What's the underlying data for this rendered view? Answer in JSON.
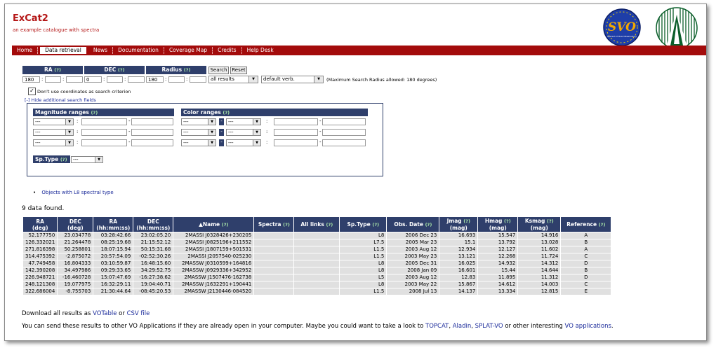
{
  "app": {
    "title": "ExCat2",
    "subtitle": "an example catalogue with spectra",
    "logo_text": "SVO",
    "logo_caption": "Spanish Virtual Observatory"
  },
  "nav": {
    "items": [
      {
        "label": "Home"
      },
      {
        "label": "Data retrieval",
        "active": true
      },
      {
        "label": "News"
      },
      {
        "label": "Documentation"
      },
      {
        "label": "Coverage Map"
      },
      {
        "label": "Credits"
      },
      {
        "label": "Help Desk"
      }
    ]
  },
  "search": {
    "ra_label": "RA",
    "dec_label": "DEC",
    "radius_label": "Radius",
    "help": "(?)",
    "ra_values": [
      "180",
      "",
      ""
    ],
    "dec_values": [
      "0",
      "",
      ""
    ],
    "radius_values": [
      "180",
      "",
      ""
    ],
    "search_button": "Search",
    "reset_button": "Reset",
    "results_select": "all results",
    "verb_select": "default verb.",
    "max_radius_note": "(Maximum Search Radius allowed: 180 degrees)",
    "no_coords_label": "Don't use coordinates as search criterion",
    "hide_fields_link": "[-] Hide additional search fields",
    "magnitude_ranges": "Magnitude ranges",
    "color_ranges": "Color ranges",
    "sptype_label": "Sp.Type",
    "select_placeholder": "---",
    "dash": "-"
  },
  "objects_link": "Objects with L8 spectral type",
  "found_text": "9 data found.",
  "table": {
    "headers": [
      {
        "line1": "RA",
        "line2": "(deg)"
      },
      {
        "line1": "DEC",
        "line2": "(deg)"
      },
      {
        "line1": "RA",
        "line2": "(hh:mm:ss)"
      },
      {
        "line1": "DEC",
        "line2": "(hh:mm:ss)"
      },
      {
        "line1": "▲Name",
        "help": "(?)"
      },
      {
        "line1": "Spectra",
        "help": "(?)"
      },
      {
        "line1": "All links",
        "help": "(?)"
      },
      {
        "line1": "Sp.Type",
        "help": "(?)"
      },
      {
        "line1": "Obs. Date",
        "help": "(?)"
      },
      {
        "line1": "Jmag",
        "help": "(?)",
        "line2": "(mag)"
      },
      {
        "line1": "Hmag",
        "help": "(?)",
        "line2": "(mag)"
      },
      {
        "line1": "Ksmag",
        "help": "(?)",
        "line2": "(mag)"
      },
      {
        "line1": "Reference",
        "help": "(?)"
      }
    ],
    "rows": [
      [
        "52.177750",
        "23.034778",
        "03:28:42.66",
        "23:02:05.20",
        "2MASSI J0328426+230205",
        "",
        "",
        "L8",
        "2006 Dec 23",
        "16.693",
        "15.547",
        "14.916",
        "A"
      ],
      [
        "126.332021",
        "21.264478",
        "08:25:19.68",
        "21:15:52.12",
        "2MASSI J0825196+211552",
        "",
        "",
        "L7.5",
        "2005 Mar 23",
        "15.1",
        "13.792",
        "13.028",
        "B"
      ],
      [
        "271.816398",
        "50.258801",
        "18:07:15.94",
        "50:15:31.68",
        "2MASSI J1807159+501531",
        "",
        "",
        "L1.5",
        "2003 Aug 12",
        "12.934",
        "12.127",
        "11.602",
        "A"
      ],
      [
        "314.475392",
        "-2.875072",
        "20:57:54.09",
        "-02:52:30.26",
        "2MASSI J2057540-025230",
        "",
        "",
        "L1.5",
        "2003 May 23",
        "13.121",
        "12.268",
        "11.724",
        "C"
      ],
      [
        "47.749458",
        "16.804333",
        "03:10:59.87",
        "16:48:15.60",
        "2MASSW J0310599+164816",
        "",
        "",
        "L8",
        "2005 Dec 31",
        "16.025",
        "14.932",
        "14.312",
        "D"
      ],
      [
        "142.390208",
        "34.497986",
        "09:29:33.65",
        "34:29:52.75",
        "2MASSW J0929336+342952",
        "",
        "",
        "L8",
        "2008 Jan 09",
        "16.601",
        "15.44",
        "14.644",
        "B"
      ],
      [
        "226.948721",
        "-16.460728",
        "15:07:47.69",
        "-16:27:38.62",
        "2MASSW J1507476-162738",
        "",
        "",
        "L5",
        "2003 Aug 12",
        "12.83",
        "11.895",
        "11.312",
        "D"
      ],
      [
        "248.121308",
        "19.077975",
        "16:32:29.11",
        "19:04:40.71",
        "2MASSW J1632291+190441",
        "",
        "",
        "L8",
        "2003 May 22",
        "15.867",
        "14.612",
        "14.003",
        "C"
      ],
      [
        "322.686004",
        "-8.755703",
        "21:30:44.64",
        "-08:45:20.53",
        "2MASSW J2130446-084520",
        "",
        "",
        "L1.5",
        "2008 Jul 13",
        "14.137",
        "13.334",
        "12.815",
        "E"
      ]
    ]
  },
  "download": {
    "prefix": "Download all results as",
    "votable": "VOTable",
    "or": "or",
    "csv": "CSV file"
  },
  "vo": {
    "text": "You can send these results to other VO Applications if they are already open in your computer. Maybe you could want to take a look to",
    "topcat": "TOPCAT",
    "comma": ",",
    "aladin": "Aladin",
    "splat": "SPLAT-VO",
    "or_other": "or other interesting",
    "vo_apps": "VO applications",
    "period": "."
  },
  "colors": {
    "brand_red": "#a30b0b",
    "header_navy": "#2f3f6b",
    "link_blue": "#1a2a9a"
  }
}
